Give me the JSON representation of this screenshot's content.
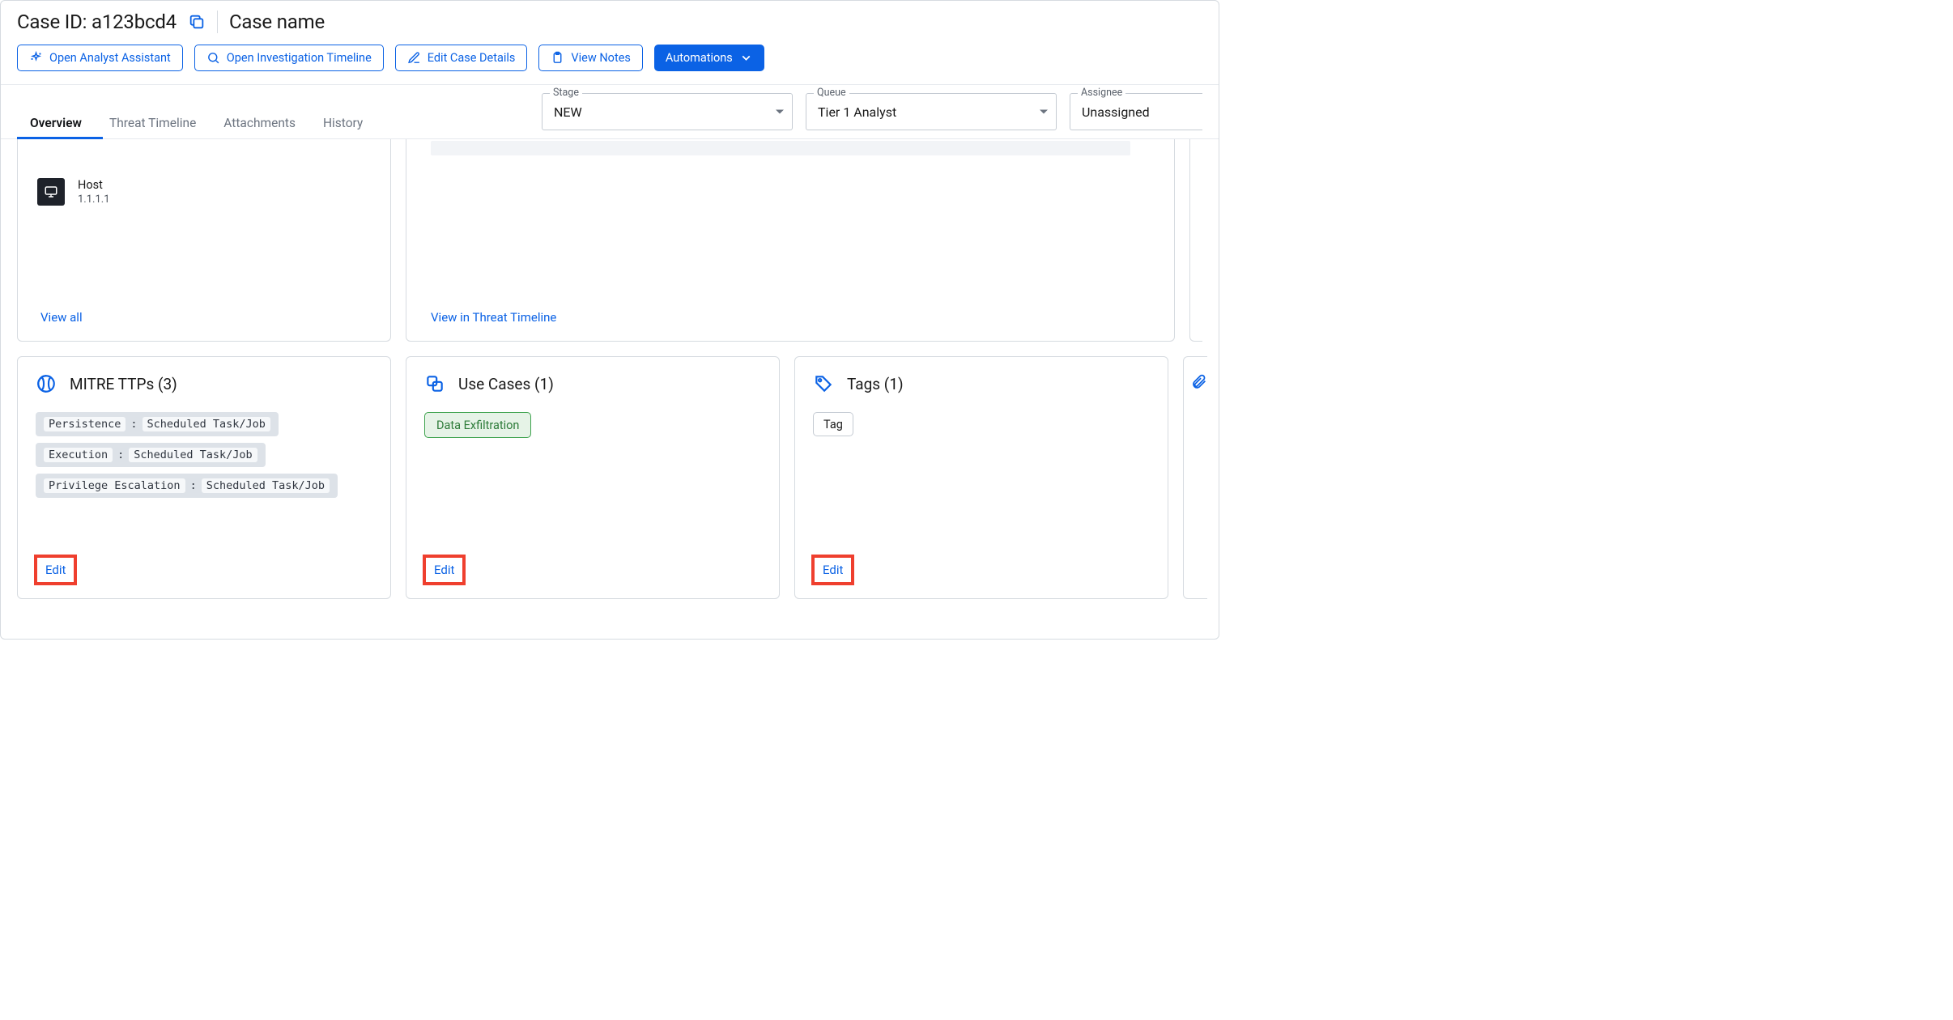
{
  "header": {
    "case_id_label": "Case ID: a123bcd4",
    "case_name": "Case name"
  },
  "actions": {
    "open_assistant": "Open Analyst Assistant",
    "open_timeline": "Open Investigation Timeline",
    "edit_details": "Edit Case Details",
    "view_notes": "View Notes",
    "automations": "Automations"
  },
  "tabs": {
    "overview": "Overview",
    "threat_timeline": "Threat Timeline",
    "attachments": "Attachments",
    "history": "History"
  },
  "selectors": {
    "stage_label": "Stage",
    "stage_value": "NEW",
    "queue_label": "Queue",
    "queue_value": "Tier 1 Analyst",
    "assignee_label": "Assignee",
    "assignee_value": "Unassigned"
  },
  "host_panel": {
    "label": "Host",
    "value": "1.1.1.1",
    "view_all": "View all"
  },
  "timeline_panel": {
    "view_link": "View in Threat Timeline"
  },
  "cards": {
    "mitre": {
      "title": "MITRE TTPs (3)",
      "items": [
        {
          "category": "Persistence",
          "technique": "Scheduled Task/Job"
        },
        {
          "category": "Execution",
          "technique": "Scheduled Task/Job"
        },
        {
          "category": "Privilege Escalation",
          "technique": "Scheduled Task/Job"
        }
      ],
      "edit": "Edit"
    },
    "usecases": {
      "title": "Use Cases (1)",
      "items": [
        "Data Exfiltration"
      ],
      "edit": "Edit"
    },
    "tags": {
      "title": "Tags (1)",
      "items": [
        "Tag"
      ],
      "edit": "Edit"
    }
  }
}
